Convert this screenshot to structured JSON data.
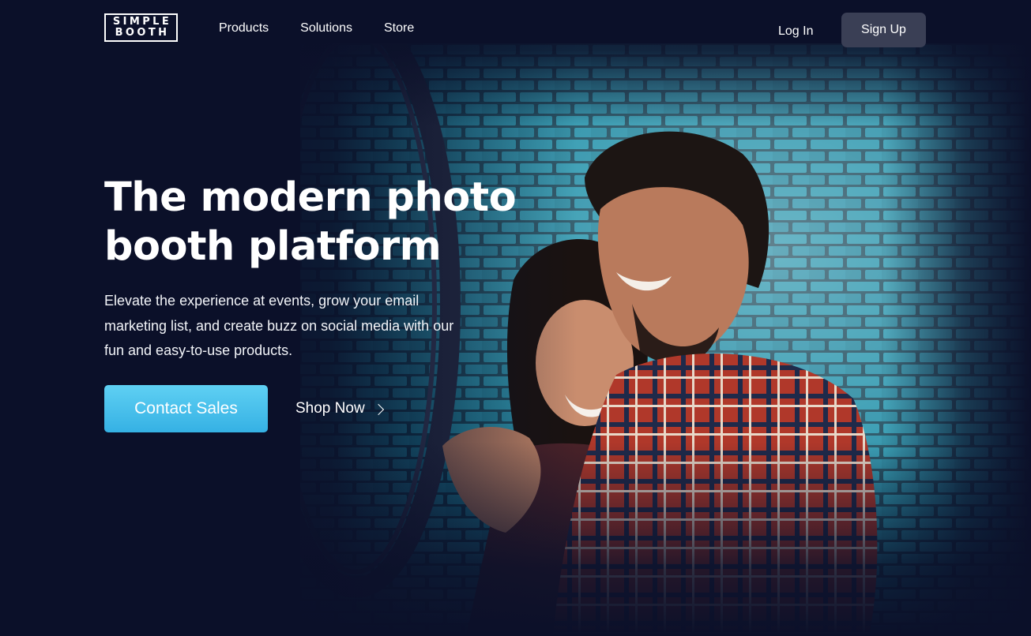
{
  "brand": {
    "logo_line1": "SIMPLE",
    "logo_line2": "BOOTH"
  },
  "nav": {
    "items": [
      {
        "label": "Products"
      },
      {
        "label": "Solutions"
      },
      {
        "label": "Store"
      }
    ],
    "login_label": "Log In",
    "signup_label": "Sign Up"
  },
  "hero": {
    "title_line1": "The modern photo",
    "title_line2": "booth platform",
    "subtitle": "Elevate the experience at events, grow your email marketing list, and create buzz on social media with our fun and easy-to-use products.",
    "primary_cta": "Contact Sales",
    "secondary_cta": "Shop Now",
    "image_icon": "hero-photo-couple"
  },
  "colors": {
    "page_background": "#0b1029",
    "cta_blue": "#35b1e4",
    "signup_button": "#3a3f55",
    "text": "#ffffff"
  }
}
